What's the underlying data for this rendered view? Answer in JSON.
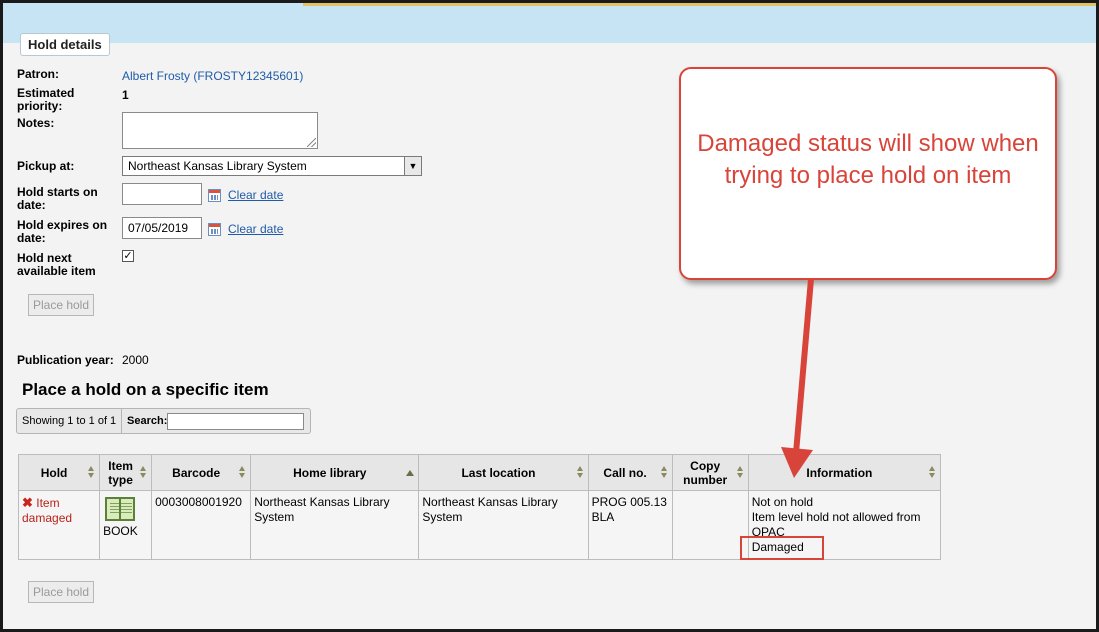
{
  "legend": "Hold details",
  "labels": {
    "patron": "Patron:",
    "estimated_priority": "Estimated priority:",
    "notes": "Notes:",
    "pickup_at": "Pickup at:",
    "hold_starts_on": "Hold starts on date:",
    "hold_expires_on": "Hold expires on date:",
    "hold_next": "Hold next available item",
    "publication_year": "Publication year:"
  },
  "values": {
    "patron": "Albert Frosty (FROSTY12345601)",
    "estimated_priority": "1",
    "pickup_at": "Northeast Kansas Library System",
    "hold_starts_on": "",
    "hold_expires_on": "07/05/2019",
    "hold_next_checked": "✓",
    "publication_year": "2000"
  },
  "links": {
    "clear_date": "Clear date"
  },
  "buttons": {
    "place_hold": "Place hold"
  },
  "section_title": "Place a hold on a specific item",
  "datatable": {
    "info": "Showing 1 to 1 of 1",
    "search_label": "Search:"
  },
  "table": {
    "headers": [
      "Hold",
      "Item type",
      "Barcode",
      "Home library",
      "Last location",
      "Call no.",
      "Copy number",
      "Information"
    ],
    "row": {
      "hold_status_icon": "✖",
      "hold": "Item damaged",
      "item_type": "BOOK",
      "barcode": "0003008001920",
      "home_library": "Northeast Kansas Library System",
      "last_location": "Northeast Kansas Library System",
      "call_no": "PROG 005.13 BLA",
      "copy_number": "",
      "info_1": "Not on hold",
      "info_2": "Item level hold not allowed from OPAC",
      "info_3": "Damaged"
    }
  },
  "callout": "Damaged status will show when trying to place hold on item",
  "colors": {
    "annotation": "#d9443a",
    "link": "#1f5ba8",
    "topbar": "#c7e4f5"
  }
}
